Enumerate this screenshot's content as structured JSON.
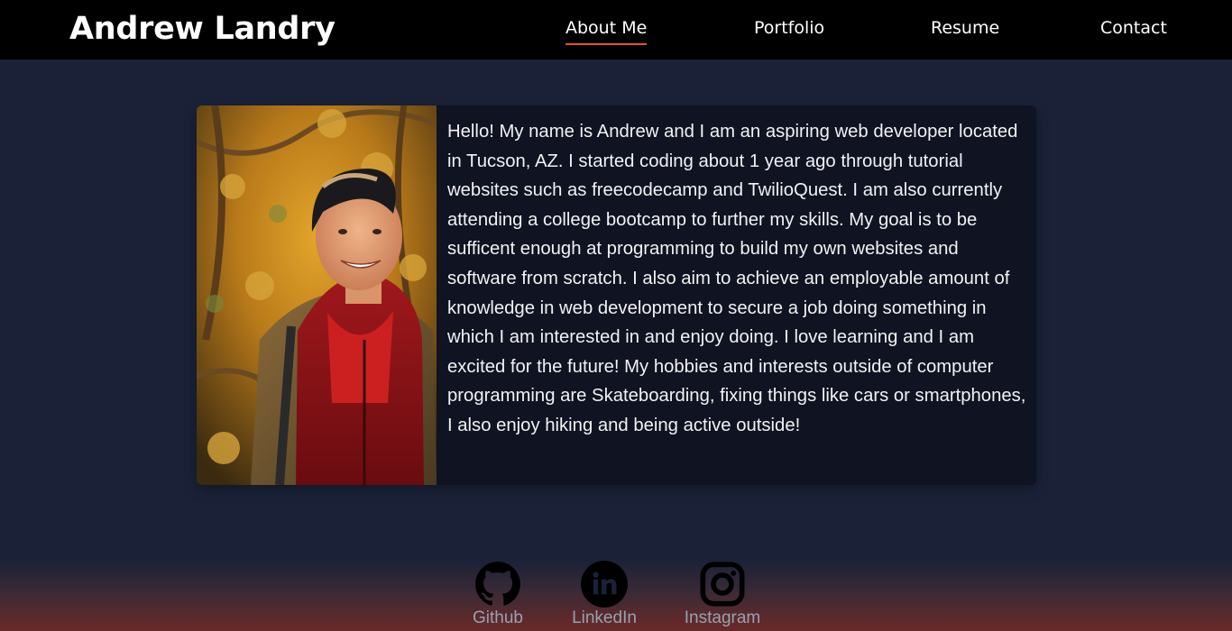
{
  "site": {
    "title": "Andrew Landry"
  },
  "nav": {
    "items": [
      {
        "label": "About Me",
        "active": true
      },
      {
        "label": "Portfolio",
        "active": false
      },
      {
        "label": "Resume",
        "active": false
      },
      {
        "label": "Contact",
        "active": false
      }
    ],
    "accent_color": "#e0581f"
  },
  "about": {
    "photo_icon": "profile-photo",
    "bio": "Hello! My name is Andrew and I am an aspiring web developer located in Tucson, AZ. I started coding about 1 year ago through tutorial websites such as freecodecamp and TwilioQuest. I am also currently attending a college bootcamp to further my skills. My goal is to be sufficent enough at programming to build my own websites and software from scratch. I also aim to achieve an employable amount of knowledge in web development to secure a job doing something in which I am interested in and enjoy doing. I love learning and I am excited for the future! My hobbies and interests outside of computer programming are Skateboarding, fixing things like cars or smartphones, I also enjoy hiking and being active outside!"
  },
  "footer": {
    "links": [
      {
        "label": "Github",
        "icon": "github-icon"
      },
      {
        "label": "LinkedIn",
        "icon": "linkedin-icon"
      },
      {
        "label": "Instagram",
        "icon": "instagram-icon"
      }
    ]
  },
  "colors": {
    "navbar": "#000000",
    "page_background": "#1b2238",
    "card_background": "#0f1322",
    "footer_gradient_end": "#6a2a27"
  }
}
